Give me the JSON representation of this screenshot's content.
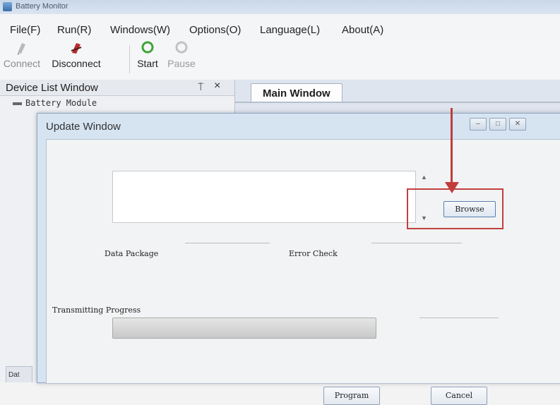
{
  "window": {
    "title": "Battery Monitor"
  },
  "menu": [
    "File(F)",
    "Run(R)",
    "Windows(W)",
    "Options(O)",
    "Language(L)",
    "About(A)"
  ],
  "toolbar": {
    "connect": "Connect",
    "disconnect": "Disconnect",
    "start": "Start",
    "pause": "Pause"
  },
  "device_list": {
    "title": "Device List Window",
    "pin": "⍑",
    "close": "×",
    "items": [
      "Battery Module"
    ]
  },
  "main_tab": "Main Window",
  "update_dialog": {
    "title": "Update Window",
    "controls": [
      "–",
      "□",
      "✕"
    ],
    "browse_label": "Browse",
    "data_package_label": "Data Package",
    "error_check_label": "Error Check",
    "progress_label": "Transmitting Progress",
    "progress_value": 0,
    "program_label": "Program",
    "cancel_label": "Cancel"
  },
  "bottom_tab": "Dat",
  "colors": {
    "highlight": "#c0403f",
    "arrow": "#c13d3b",
    "start_icon": "#3fa33a"
  }
}
